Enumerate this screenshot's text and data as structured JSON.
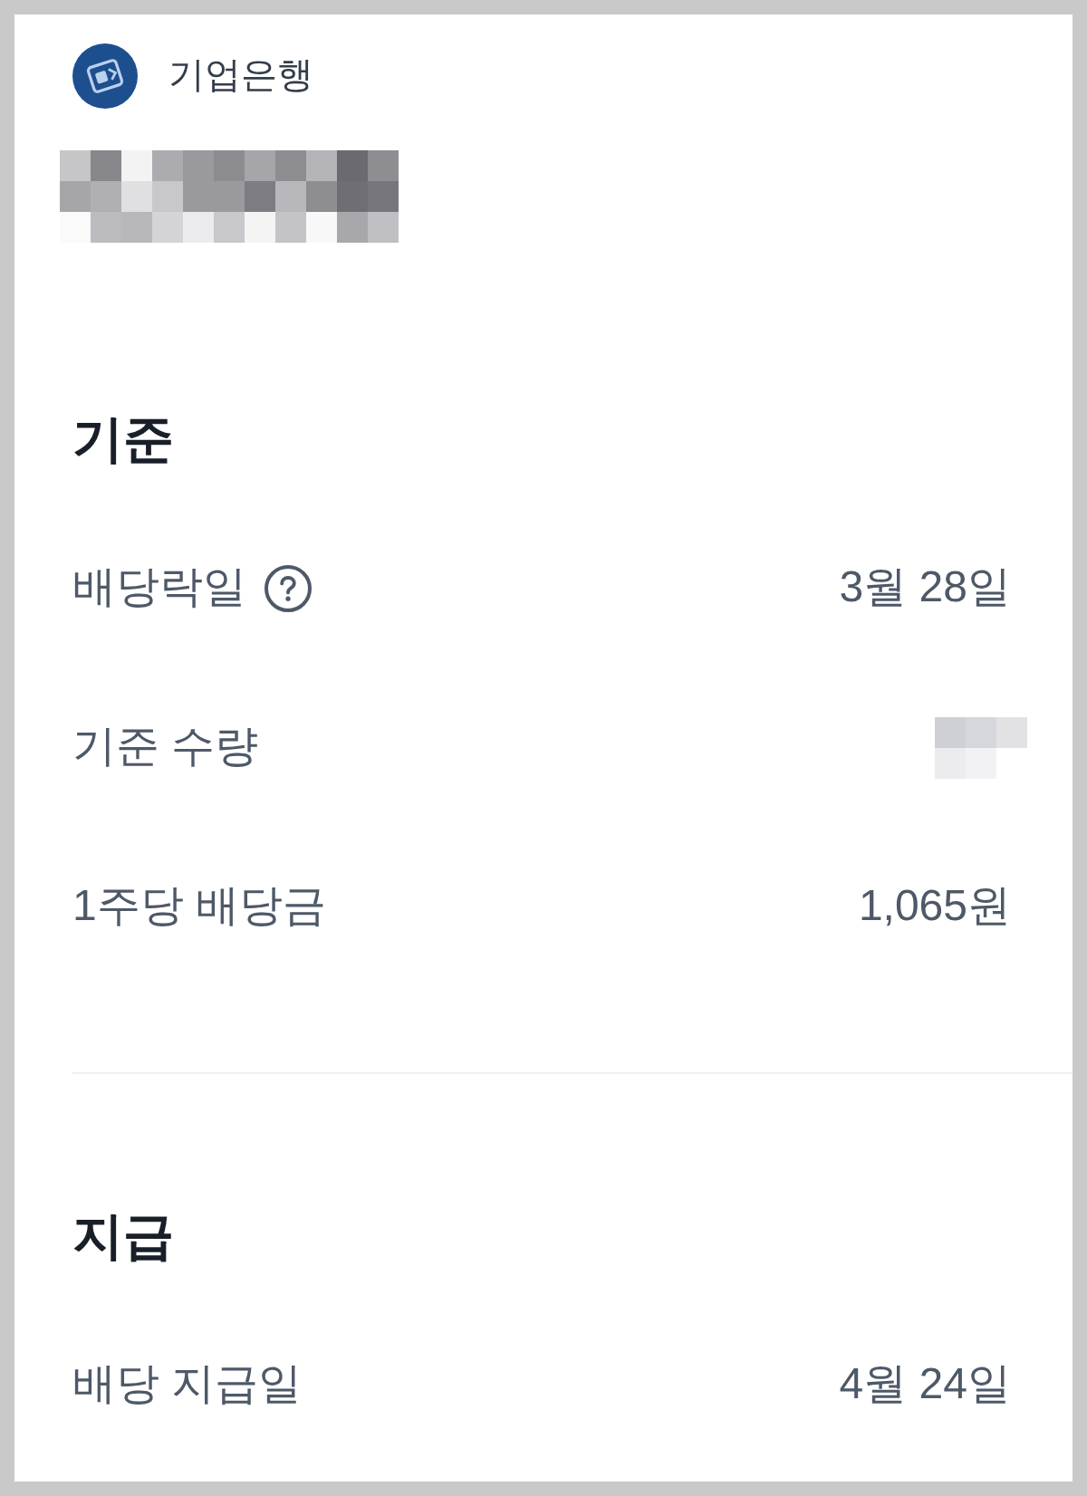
{
  "header": {
    "bank_name": "기업은행",
    "name_redacted": true
  },
  "sections": [
    {
      "title": "기준",
      "rows": [
        {
          "kind": "text",
          "label": "배당락일",
          "has_help": true,
          "value": "3월 28일"
        },
        {
          "kind": "redacted",
          "label": "기준 수량",
          "has_help": false
        },
        {
          "kind": "text",
          "label": "1주당 배당금",
          "has_help": false,
          "value": "1,065원"
        }
      ]
    },
    {
      "title": "지급",
      "rows": [
        {
          "kind": "text",
          "label": "배당 지급일",
          "has_help": false,
          "value": "4월 24일"
        }
      ]
    }
  ]
}
